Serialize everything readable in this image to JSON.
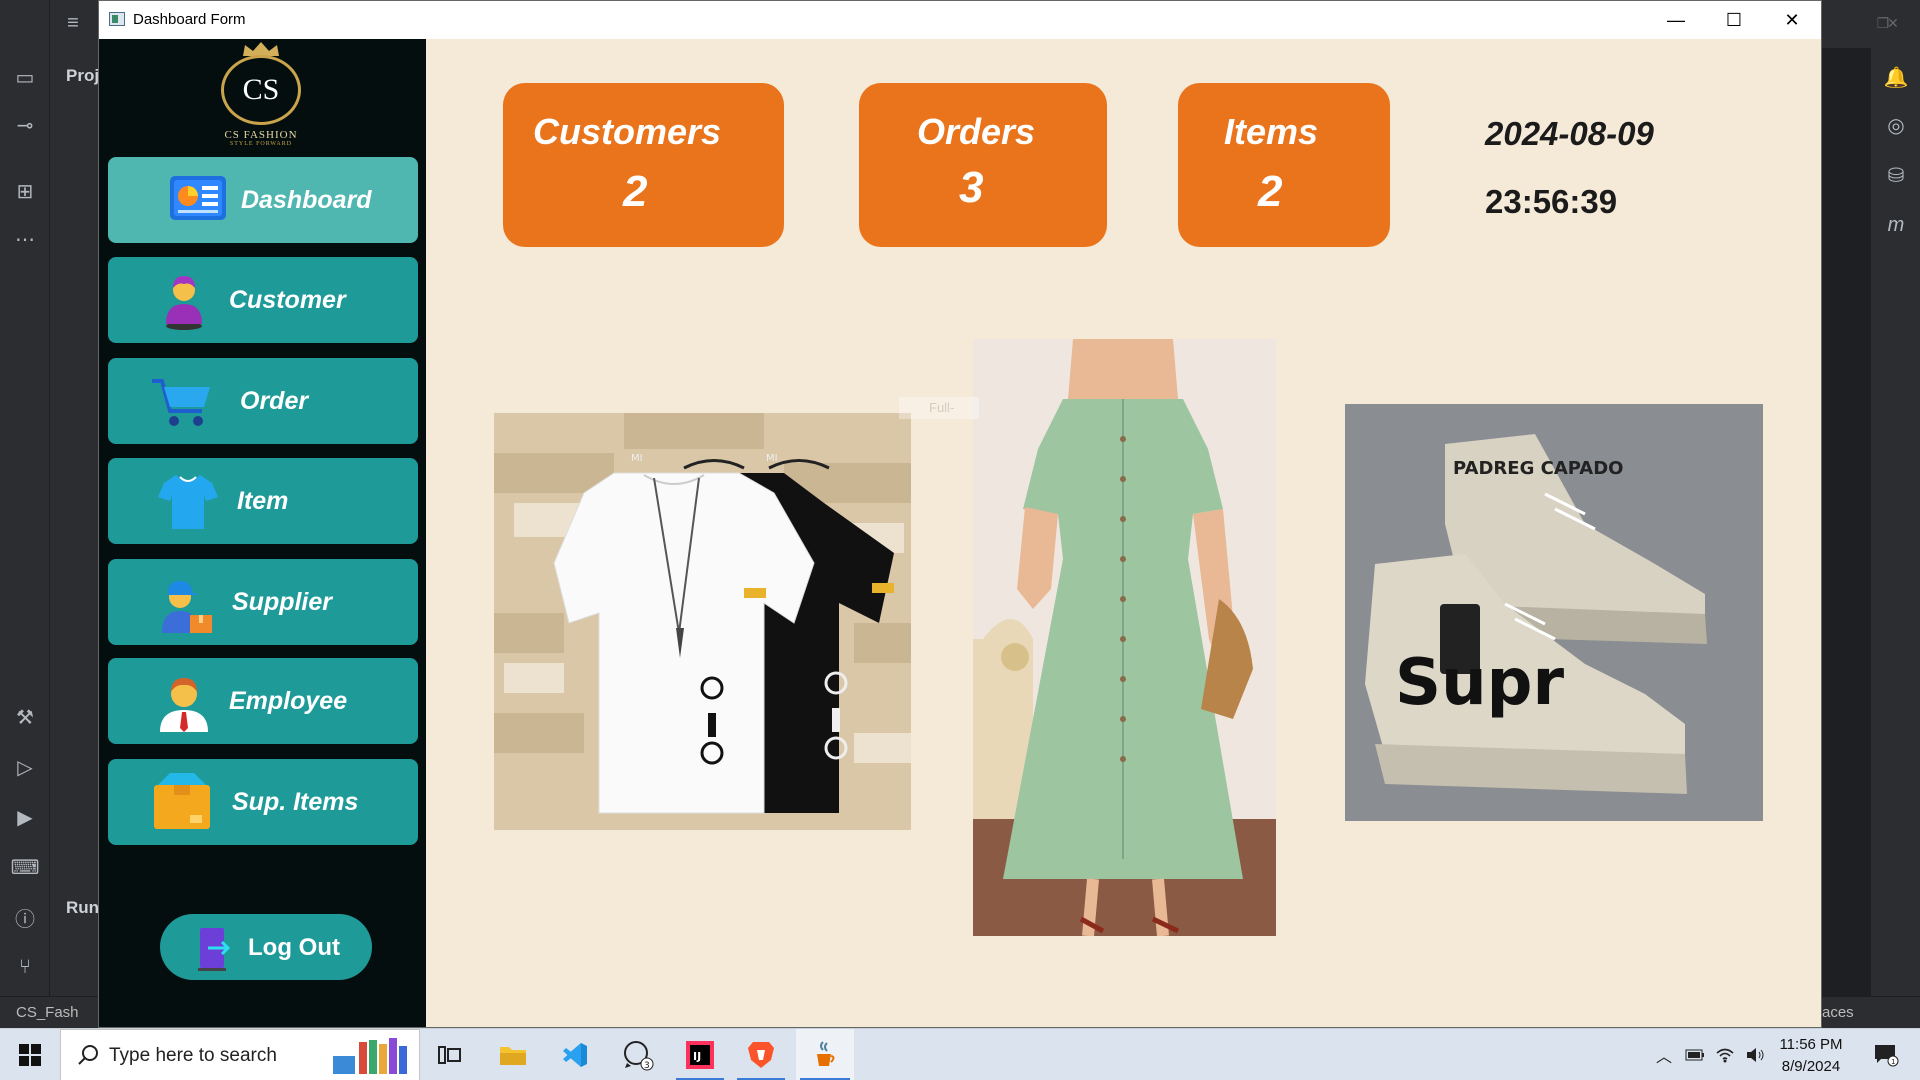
{
  "ide": {
    "project_tab": "Proj",
    "run_tab": "Run",
    "status_left": "CS_Fash",
    "status_right": "aces",
    "ghost_text": "Full-"
  },
  "window": {
    "title": "Dashboard Form",
    "minimize": "—",
    "maximize": "☐",
    "close": "✕"
  },
  "logo": {
    "monogram": "CS",
    "brand": "CS FASHION",
    "tagline": "STYLE FORWARD"
  },
  "nav": [
    {
      "label": "Dashboard",
      "icon": "dashboard-chart-icon",
      "active": true
    },
    {
      "label": "Customer",
      "icon": "customer-person-icon",
      "active": false
    },
    {
      "label": "Order",
      "icon": "shopping-cart-icon",
      "active": false
    },
    {
      "label": "Item",
      "icon": "tshirt-icon",
      "active": false
    },
    {
      "label": "Supplier",
      "icon": "delivery-man-icon",
      "active": false
    },
    {
      "label": "Employee",
      "icon": "employee-icon",
      "active": false
    },
    {
      "label": "Sup. Items",
      "icon": "box-icon",
      "active": false
    }
  ],
  "logout": {
    "label": "Log Out",
    "icon": "exit-door-icon"
  },
  "stats": {
    "customers": {
      "label": "Customers",
      "value": "2"
    },
    "orders": {
      "label": "Orders",
      "value": "3"
    },
    "items": {
      "label": "Items",
      "value": "2"
    }
  },
  "datetime": {
    "date": "2024-08-09",
    "time": "23:56:39"
  },
  "images": [
    {
      "name": "tshirts-image",
      "print_left": "MI",
      "print_right": "MI"
    },
    {
      "name": "green-dress-image"
    },
    {
      "name": "sneakers-image",
      "text1": "PADREG CAPADO",
      "text2": "Supr"
    }
  ],
  "taskbar": {
    "search_placeholder": "Type here to search",
    "whatsapp_badge": "3",
    "time": "11:56 PM",
    "date": "8/9/2024",
    "notification_count": "1"
  },
  "colors": {
    "sidebar": "#040e0e",
    "nav_button": "#1e9a99",
    "nav_active": "#4fb6b0",
    "card": "#e9741c",
    "content_bg": "#f5e9d8"
  }
}
